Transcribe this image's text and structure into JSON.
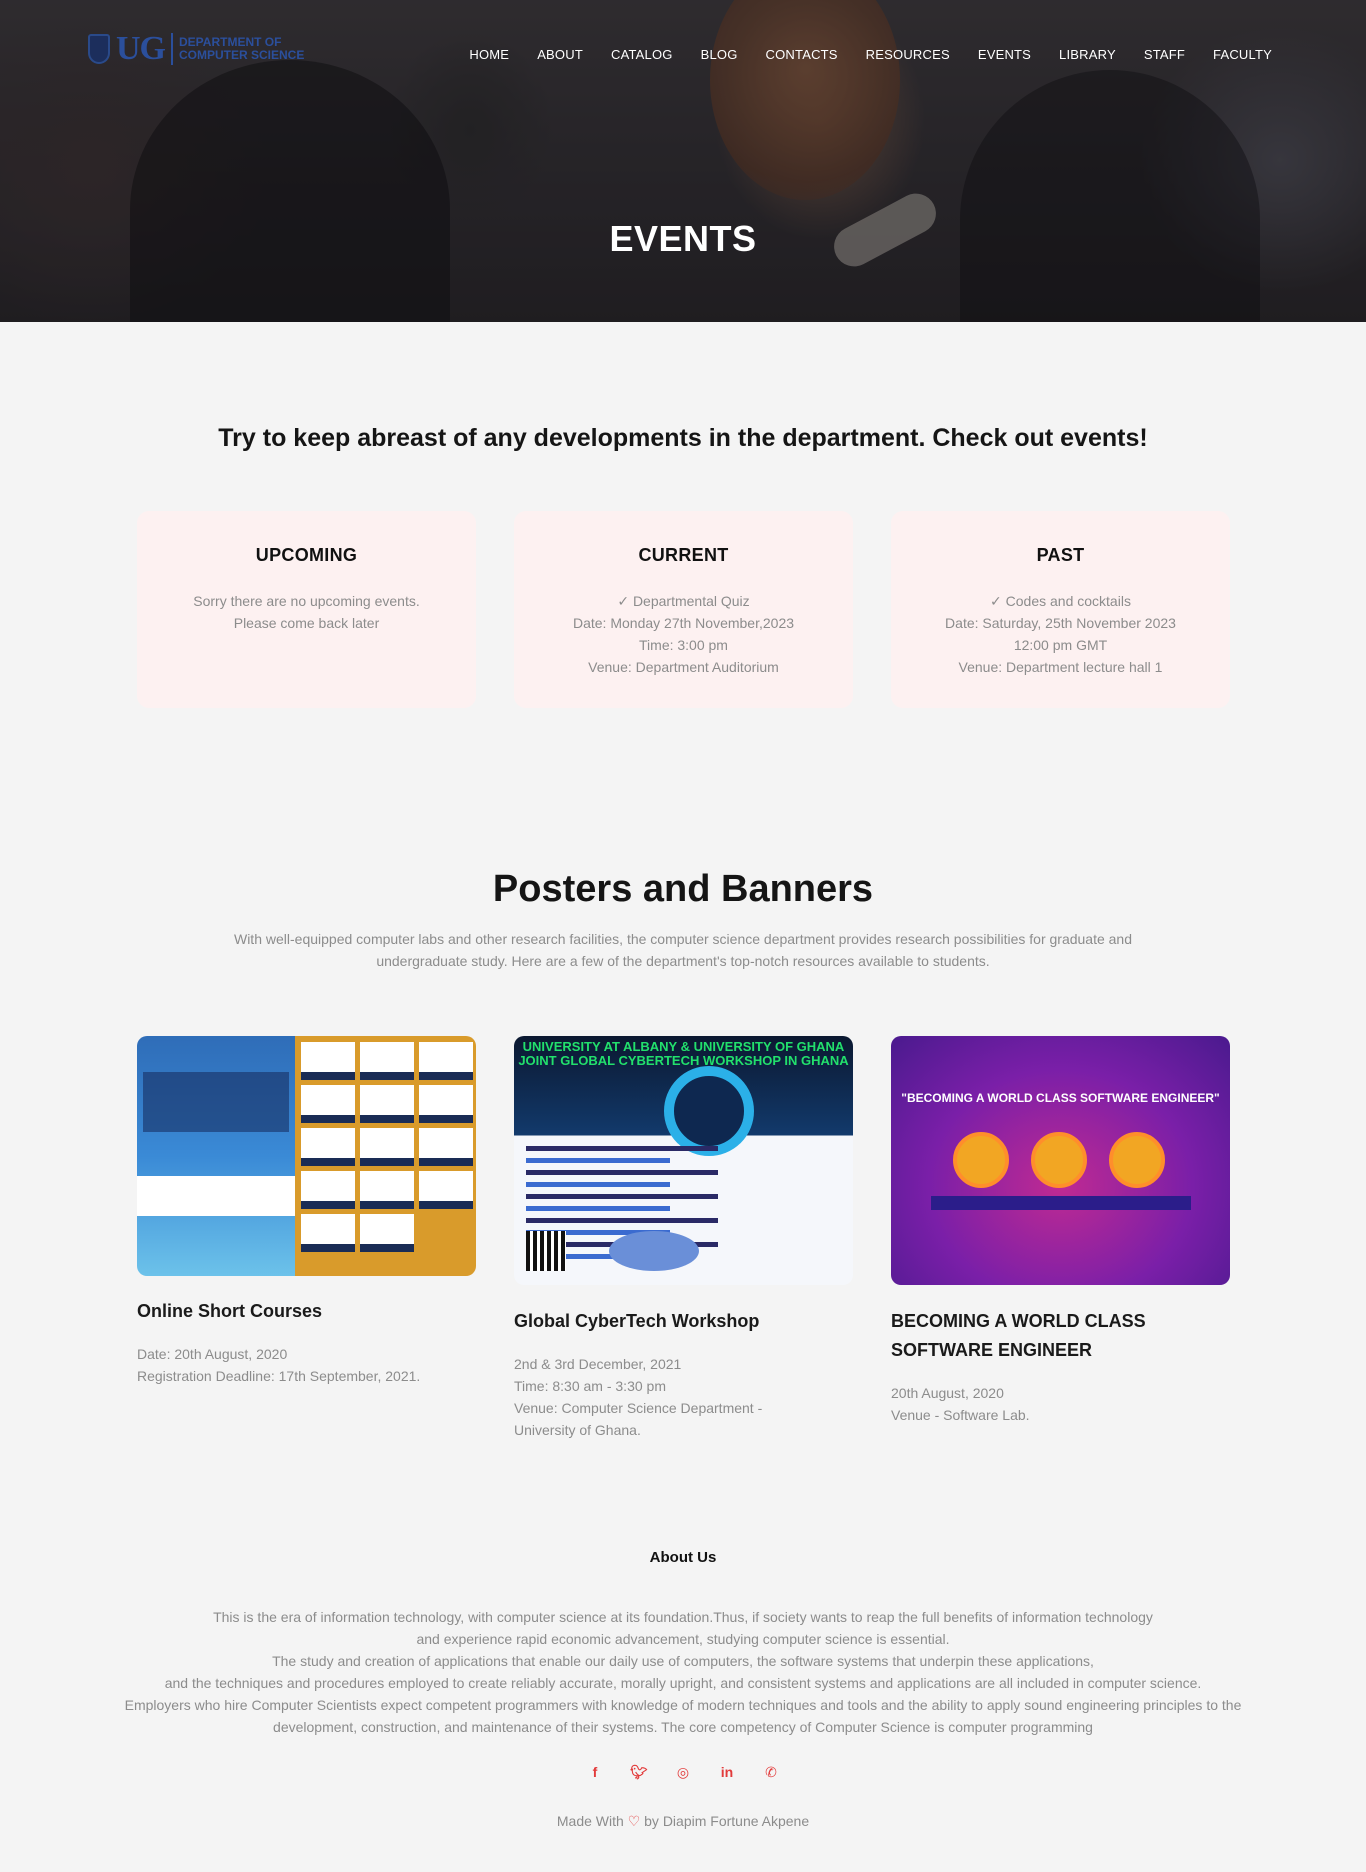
{
  "logo": {
    "short": "UG",
    "dept_line1": "Department of",
    "dept_line2": "Computer Science"
  },
  "nav": [
    "HOME",
    "ABOUT",
    "CATALOG",
    "BLOG",
    "CONTACTS",
    "RESOURCES",
    "EVENTS",
    "LIBRARY",
    "STAFF",
    "FACULTY"
  ],
  "hero": {
    "title": "EVENTS"
  },
  "intro": "Try to keep abreast of any developments in the department. Check out events!",
  "events": [
    {
      "heading": "UPCOMING",
      "lines": [
        "Sorry there are no upcoming events.",
        "Please come back later"
      ]
    },
    {
      "heading": "CURRENT",
      "lines": [
        "✓ Departmental Quiz",
        "Date: Monday 27th November,2023",
        "Time: 3:00 pm",
        "Venue: Department Auditorium"
      ]
    },
    {
      "heading": "PAST",
      "lines": [
        "✓ Codes and cocktails",
        "Date: Saturday, 25th November 2023",
        "12:00 pm GMT",
        "Venue: Department lecture hall 1"
      ]
    }
  ],
  "posters_section": {
    "title": "Posters and Banners",
    "description_line1": "With well-equipped computer labs and other research facilities, the computer science department provides research possibilities for graduate and",
    "description_line2": "undergraduate study. Here are a few of the department's top-notch resources available to students."
  },
  "posters": [
    {
      "title": "Online Short Courses",
      "info": [
        "Date: 20th August, 2020",
        "Registration Deadline: 17th September, 2021."
      ]
    },
    {
      "title": "Global CyberTech Workshop",
      "image_text": "UNIVERSITY AT ALBANY & UNIVERSITY OF GHANA JOINT GLOBAL CYBERTECH WORKSHOP IN GHANA",
      "info": [
        "2nd & 3rd December, 2021",
        "Time: 8:30 am - 3:30 pm",
        "Venue: Computer Science Department -",
        "University of Ghana."
      ]
    },
    {
      "title_line1": "BECOMING A WORLD CLASS",
      "title_line2": "SOFTWARE ENGINEER",
      "image_text": "\"BECOMING A WORLD CLASS SOFTWARE ENGINEER\"",
      "info": [
        "20th August, 2020",
        "Venue - Software Lab."
      ]
    }
  ],
  "about": {
    "title": "About Us",
    "lines": [
      "This is the era of information technology, with computer science at its foundation.Thus, if society wants to reap the full benefits of information technology",
      "and experience rapid economic advancement, studying computer science is essential.",
      "The study and creation of applications that enable our daily use of computers, the software systems that underpin these applications,",
      "and the techniques and procedures employed to create reliably accurate, morally upright, and consistent systems and applications are all included in computer science.",
      "Employers who hire Computer Scientists expect competent programmers with knowledge of modern techniques and tools and the ability to apply sound engineering principles to the",
      "development, construction, and maintenance of their systems. The core competency of Computer Science is computer programming"
    ]
  },
  "social": [
    "facebook-icon",
    "twitter-icon",
    "instagram-icon",
    "linkedin-icon",
    "whatsapp-icon"
  ],
  "footer": {
    "made_prefix": "Made With",
    "made_suffix": "by Diapim Fortune Akpene"
  },
  "colors": {
    "accent": "#e23b3b",
    "card_bg": "#fdf1f1",
    "page_bg": "#f4f4f4"
  }
}
